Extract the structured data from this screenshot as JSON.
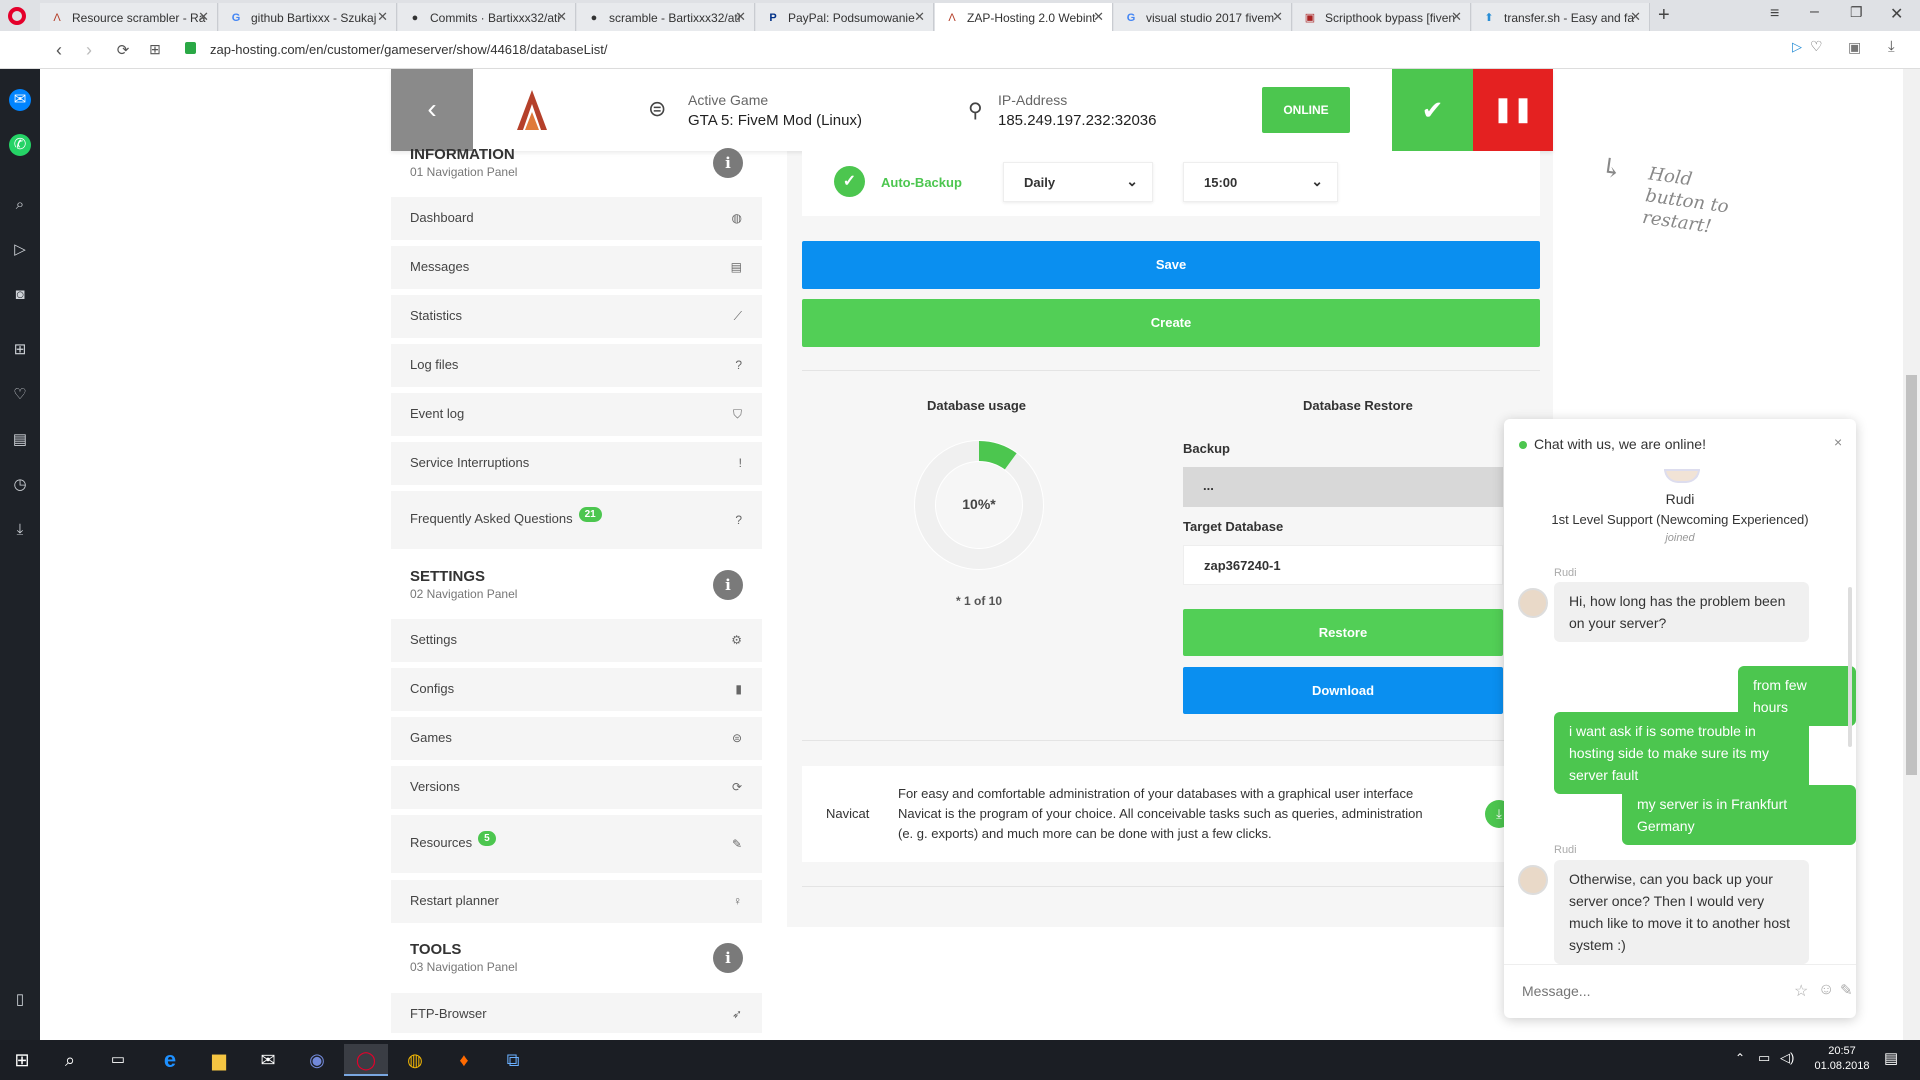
{
  "browser": {
    "tabs": [
      {
        "label": "Resource scrambler - Ra",
        "icon": "zap-logo-icon"
      },
      {
        "label": "github Bartixxx - Szukaj",
        "icon": "google-icon"
      },
      {
        "label": "Commits · Bartixxx32/ati",
        "icon": "github-icon"
      },
      {
        "label": "scramble - Bartixxx32/ati",
        "icon": "github-icon"
      },
      {
        "label": "PayPal: Podsumowanie",
        "icon": "paypal-icon"
      },
      {
        "label": "ZAP-Hosting 2.0 Webint",
        "icon": "zap-logo-icon",
        "active": true
      },
      {
        "label": "visual studio 2017 fivem",
        "icon": "google-icon"
      },
      {
        "label": "Scripthook bypass [fiven",
        "icon": "forum-icon"
      },
      {
        "label": "transfer.sh - Easy and fa",
        "icon": "transfer-icon"
      }
    ],
    "url": "zap-hosting.com/en/customer/gameserver/show/44618/databaseList/"
  },
  "server_header": {
    "active_game_label": "Active Game",
    "active_game_value": "GTA 5: FiveM Mod (Linux)",
    "ip_label": "IP-Address",
    "ip_value": "185.249.197.232:32036",
    "status": "ONLINE",
    "colors": {
      "green": "#4cc64f",
      "red": "#e42121",
      "grey": "#8a8a8a"
    }
  },
  "nav": {
    "information": {
      "title": "INFORMATION",
      "subtitle": "01 Navigation Panel"
    },
    "info_items": [
      {
        "label": "Dashboard",
        "icon": "dashboard-icon",
        "glyph": "◍"
      },
      {
        "label": "Messages",
        "icon": "keyboard-icon",
        "glyph": "▤"
      },
      {
        "label": "Statistics",
        "icon": "chart-icon",
        "glyph": "⟋"
      },
      {
        "label": "Log files",
        "icon": "question-icon",
        "glyph": "?"
      },
      {
        "label": "Event log",
        "icon": "shield-icon",
        "glyph": "⛉"
      },
      {
        "label": "Service Interruptions",
        "icon": "exclamation-icon",
        "glyph": "!"
      },
      {
        "label": "Frequently Asked Questions",
        "icon": "question-icon",
        "glyph": "?",
        "badge": "21"
      }
    ],
    "settings": {
      "title": "SETTINGS",
      "subtitle": "02 Navigation Panel"
    },
    "settings_items": [
      {
        "label": "Settings",
        "icon": "cogs-icon",
        "glyph": "⚙"
      },
      {
        "label": "Configs",
        "icon": "file-icon",
        "glyph": "▮"
      },
      {
        "label": "Games",
        "icon": "gamepad-icon",
        "glyph": "⊜"
      },
      {
        "label": "Versions",
        "icon": "refresh-icon",
        "glyph": "⟳"
      },
      {
        "label": "Resources",
        "icon": "puzzle-icon",
        "glyph": "✎",
        "badge": "5"
      },
      {
        "label": "Restart planner",
        "icon": "lightbulb-icon",
        "glyph": "♀"
      }
    ],
    "tools": {
      "title": "TOOLS",
      "subtitle": "03 Navigation Panel"
    },
    "tools_items": [
      {
        "label": "FTP-Browser",
        "icon": "rocket-icon",
        "glyph": "➶"
      }
    ]
  },
  "backup": {
    "auto_backup_label": "Auto-Backup",
    "frequency": "Daily",
    "time": "15:00",
    "save_label": "Save",
    "create_label": "Create",
    "colors": {
      "blue": "#0a8ff0",
      "green": "#52cf56"
    }
  },
  "usage": {
    "title": "Database usage",
    "percent": 10,
    "percent_label": "10%*",
    "note": "* 1 of 10"
  },
  "restore": {
    "title": "Database Restore",
    "backup_label": "Backup",
    "backup_value": "...",
    "target_label": "Target Database",
    "target_value": "zap367240-1",
    "restore_label": "Restore",
    "download_label": "Download"
  },
  "navicat": {
    "label": "Navicat",
    "text": "For easy and comfortable administration of your databases with a graphical user interface Navicat is the program of your choice. All conceivable tasks such as queries, administration (e. g. exports) and much more can be done with just a few clicks."
  },
  "hint": "Hold button to restart!",
  "chat": {
    "header": "Chat with us, we are online!",
    "agent_name": "Rudi",
    "agent_role": "1st Level Support (Newcoming Experienced)",
    "joined": "joined",
    "sender_label": "Rudi",
    "messages": [
      {
        "from": "agent",
        "text": "Hi, how long has the problem been on your server?"
      },
      {
        "from": "user",
        "text": "from few hours"
      },
      {
        "from": "user",
        "text": "i want ask if is some trouble in hosting side to make sure its my server fault"
      },
      {
        "from": "user",
        "text": "my server is in Frankfurt Germany"
      },
      {
        "from": "agent",
        "text": "Otherwise, can you back up your server once? Then I would very much like to move it to another host system :)"
      }
    ],
    "input_placeholder": "Message..."
  },
  "taskbar": {
    "time": "20:57",
    "date": "01.08.2018"
  }
}
